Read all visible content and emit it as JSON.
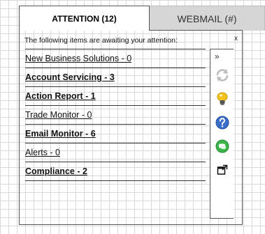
{
  "tabs": [
    {
      "label": "ATTENTION (12)",
      "active": true
    },
    {
      "label": "WEBMAIL (#)",
      "active": false
    }
  ],
  "panel": {
    "intro": "The following items are awaiting your attention:",
    "close_label": "x"
  },
  "items": [
    {
      "label": "New Business Solutions - 0",
      "bold": false
    },
    {
      "label": "Account Servicing - 3",
      "bold": true
    },
    {
      "label": "Action Report - 1",
      "bold": true
    },
    {
      "label": "Trade Monitor - 0",
      "bold": false
    },
    {
      "label": "Email Monitor - 6",
      "bold": true
    },
    {
      "label": "Alerts - 0",
      "bold": false
    },
    {
      "label": "Compliance - 2",
      "bold": true
    }
  ],
  "toolbar": {
    "collapse_label": "»",
    "buttons": [
      "refresh-icon",
      "lightbulb-icon",
      "help-icon",
      "chat-icon",
      "popout-icon"
    ]
  },
  "colors": {
    "accent_blue": "#3a6fc9",
    "bulb_yellow": "#f4c21c",
    "chat_green": "#3bb54a",
    "refresh_gray": "#bdbdbd"
  }
}
